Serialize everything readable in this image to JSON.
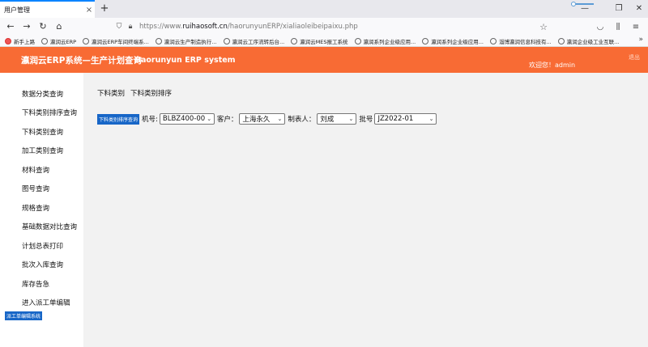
{
  "browser": {
    "tab_title": "用户管理",
    "tab_close": "×",
    "new_tab": "+",
    "url_prefix": "https://www.",
    "url_host": "ruihaosoft.cn",
    "url_path": "/haorunyunERP/xialiaoleibeipaixu.php",
    "bookmarks": [
      "新手上路",
      "瀛润云ERP",
      "瀛润云ERP车间终端系...",
      "瀛润云生产制造执行...",
      "瀛润云工序流转后台...",
      "瀛润云MES报工系统",
      "瀛润系列企业级应用...",
      "瀛润系列企业级应用...",
      "淄博瀛润信息科技有...",
      "瀛润企业级工业互联..."
    ],
    "bookmarks_more": "»"
  },
  "header": {
    "title_cn": "瀛润云ERP系统—生产计划查询",
    "title_en": "Haorunyun ERP system",
    "welcome": "欢迎您！admin",
    "logout": "退出"
  },
  "sidebar": {
    "items": [
      "数据分类查询",
      "下料类别排序查询",
      "下料类别查询",
      "加工类别查询",
      "材料查询",
      "图号查询",
      "规格查询",
      "基础数据对比查询",
      "计划总表打印",
      "批次入库查询",
      "库存告急",
      "进入派工单编辑"
    ],
    "bottom_button": "派工单编辑系统"
  },
  "main": {
    "breadcrumb": [
      "下料类别",
      "下料类别排序"
    ],
    "query_button": "下料类别排序查询",
    "filters": [
      {
        "label": "机号:",
        "value": "BLBZ400-00"
      },
      {
        "label": "客户：",
        "value": "上海永久"
      },
      {
        "label": "制表人：",
        "value": "刘成"
      },
      {
        "label": "批号",
        "value": "JZ2022-01"
      }
    ]
  }
}
